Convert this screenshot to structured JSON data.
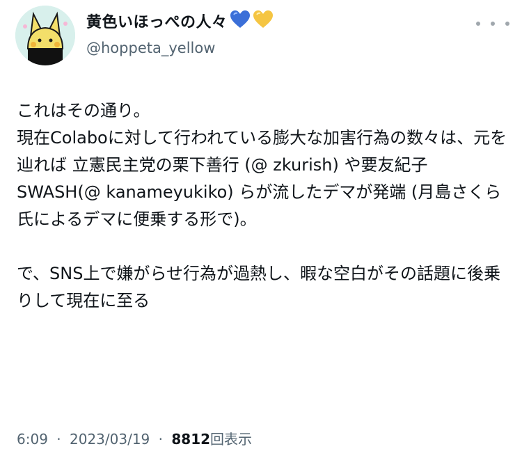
{
  "author": {
    "display_name": "黄色いほっぺの人々",
    "handle": "@hoppeta_yellow",
    "avatar_icon": "yellow-cheek-character-avatar",
    "badges": [
      "blue-heart-icon",
      "yellow-heart-icon"
    ],
    "heart_colors": {
      "blue": "#3b6fd8",
      "yellow": "#f5c542"
    }
  },
  "tweet": {
    "paragraph_1": "これはその通り。\n現在Colaboに対して行われている膨大な加害行為の数々は、元を辿れば 立憲民主党の栗下善行 (@ zkurish) や要友紀子SWASH(@ kanameyukiko) らが流したデマが発端 (月島さくら氏によるデマに便乗する形で)。",
    "paragraph_2": "で、SNS上で嫌がらせ行為が過熱し、暇な空白がその話題に後乗りして現在に至る"
  },
  "meta": {
    "time": "6:09",
    "separator": "·",
    "date": "2023/03/19",
    "views_count": "8812",
    "views_label": "回表示"
  },
  "menu": {
    "icon": "more-options-icon"
  }
}
